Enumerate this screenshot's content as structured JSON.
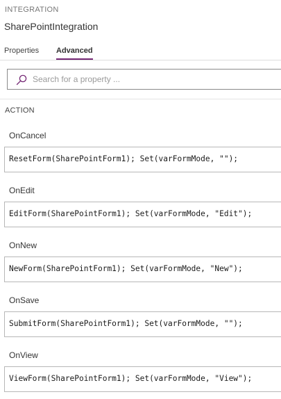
{
  "header": {
    "section_label": "INTEGRATION",
    "control_name": "SharePointIntegration"
  },
  "tabs": [
    {
      "label": "Properties",
      "active": false
    },
    {
      "label": "Advanced",
      "active": true
    }
  ],
  "search": {
    "placeholder": "Search for a property ...",
    "value": ""
  },
  "group": {
    "title": "ACTION"
  },
  "properties": [
    {
      "label": "OnCancel",
      "formula": "ResetForm(SharePointForm1); Set(varFormMode, \"\");"
    },
    {
      "label": "OnEdit",
      "formula": "EditForm(SharePointForm1); Set(varFormMode, \"Edit\");"
    },
    {
      "label": "OnNew",
      "formula": "NewForm(SharePointForm1); Set(varFormMode, \"New\");"
    },
    {
      "label": "OnSave",
      "formula": "SubmitForm(SharePointForm1); Set(varFormMode, \"\");"
    },
    {
      "label": "OnView",
      "formula": "ViewForm(SharePointForm1); Set(varFormMode, \"View\");"
    }
  ],
  "colors": {
    "accent": "#742774",
    "border": "#b7b7b7"
  },
  "icons": {
    "search": "search-icon"
  }
}
